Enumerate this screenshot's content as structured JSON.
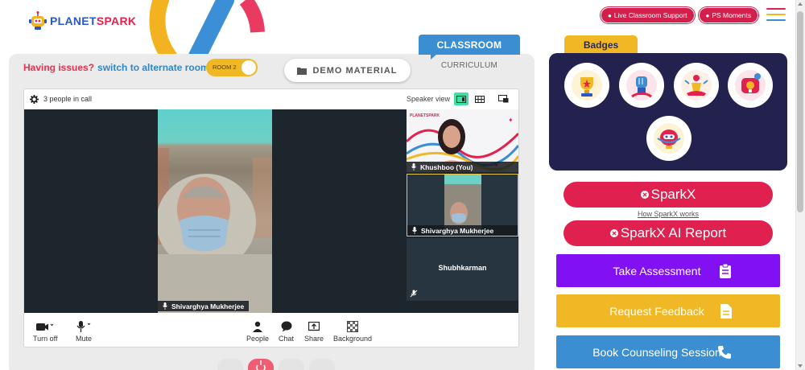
{
  "brand": {
    "part1": "PLANET",
    "part2": "SPARK",
    "blue": "#2b58c5",
    "red": "#e3214f"
  },
  "header": {
    "live_support": "Live Classroom Support",
    "ps_moments": "PS Moments",
    "menu_icon": "hamburger-icon"
  },
  "tabs": {
    "classroom": "CLASSROOM",
    "curriculum": "CURRICULUM"
  },
  "issues": {
    "question": "Having issues?",
    "switch": "switch to alternate room"
  },
  "room_toggle": {
    "label": "ROOM 2",
    "on": true
  },
  "demo_material": {
    "label": "DEMO MATERIAL",
    "icon": "folder-icon"
  },
  "call": {
    "people_count": "3 people in call",
    "speaker_view": "Speaker view",
    "main_speaker": "Shivarghya Mukherjee",
    "tiles": [
      {
        "name": "Khushboo (You)"
      },
      {
        "name": "Shivarghya Mukherjee"
      },
      {
        "name": "Shubhkarman"
      }
    ],
    "toolbar": {
      "video": "Turn off",
      "mic": "Mute",
      "people": "People",
      "chat": "Chat",
      "share": "Share",
      "background": "Background"
    }
  },
  "badges": {
    "title": "Badges",
    "items": [
      "trophy-badge-icon",
      "fist-badge-icon",
      "meditation-badge-icon",
      "idea-badge-icon",
      "robot-badge-icon"
    ]
  },
  "right": {
    "sparkx": "SparkX",
    "how_sparkx": "How SparkX works",
    "sparkx_ai": "SparkX AI Report",
    "take_assessment": "Take Assessment",
    "request_feedback": "Request Feedback",
    "book_counseling": "Book Counseling Session"
  },
  "colors": {
    "red": "#e0204f",
    "purple": "#8110f2",
    "yellow": "#f1b825",
    "blue": "#3b8ed2",
    "navy": "#23214e"
  }
}
